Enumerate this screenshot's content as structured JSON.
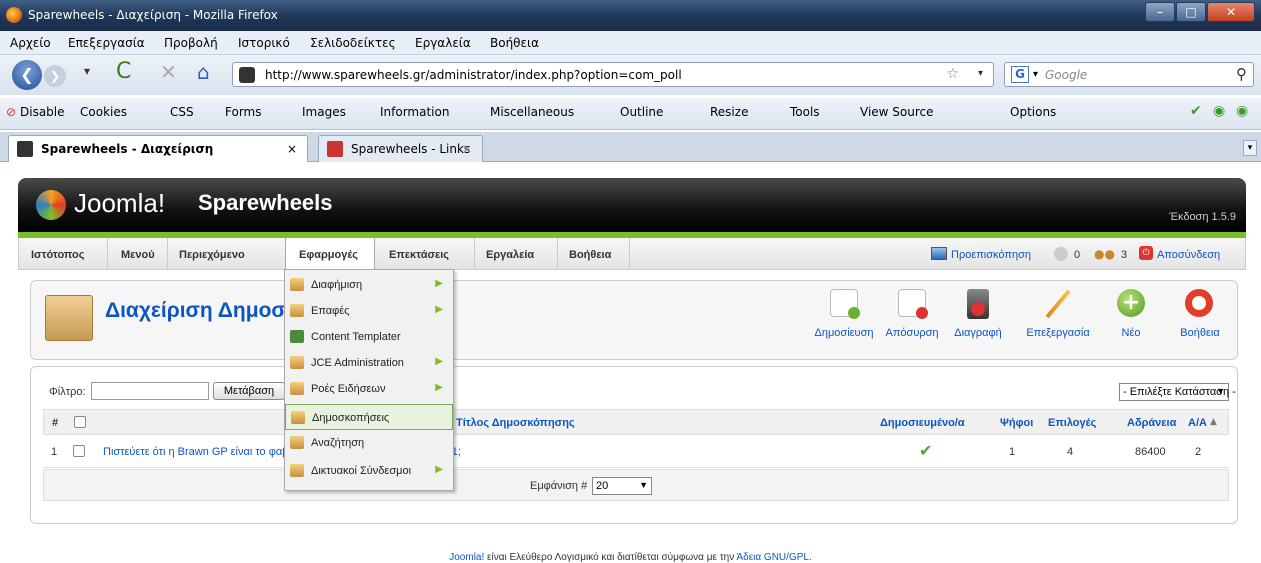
{
  "window": {
    "title": "Sparewheels - Διαχείριση - Mozilla Firefox"
  },
  "menu": [
    "Αρχείο",
    "Επεξεργασία",
    "Προβολή",
    "Ιστορικό",
    "Σελιδοδείκτες",
    "Εργαλεία",
    "Βοήθεια"
  ],
  "address": {
    "url": "http://www.sparewheels.gr/administrator/index.php?option=com_poll",
    "search_placeholder": "Google"
  },
  "devtools": [
    "Disable",
    "Cookies",
    "CSS",
    "Forms",
    "Images",
    "Information",
    "Miscellaneous",
    "Outline",
    "Resize",
    "Tools",
    "View Source",
    "Options"
  ],
  "tabs": [
    {
      "label": "Sparewheels - Διαχείριση"
    },
    {
      "label": "Sparewheels - Links"
    }
  ],
  "joomla": {
    "logo": "Joomla!",
    "site": "Sparewheels",
    "version": "Έκδοση 1.5.9",
    "nav": [
      "Ιστότοπος",
      "Μενού",
      "Περιεχόμενο",
      "Εφαρμογές",
      "Επεκτάσεις",
      "Εργαλεία",
      "Βοήθεια"
    ],
    "preview": "Προεπισκόπηση",
    "count_a": "0",
    "count_b": "3",
    "logout": "Αποσύνδεση",
    "page_title": "Διαχείριση Δημοσκοπήσεων",
    "toolbar": [
      "Δημοσίευση",
      "Απόσυρση",
      "Διαγραφή",
      "Επεξεργασία",
      "Νέο",
      "Βοήθεια"
    ],
    "filter_label": "Φίλτρο:",
    "go_button": "Μετάβαση",
    "status_select": "- Επιλέξτε Κατάσταση -",
    "columns": {
      "num": "#",
      "title": "Τίτλος Δημοσκόπησης",
      "published": "Δημοσιευμένο/α",
      "votes": "Ψήφοι",
      "options": "Επιλογές",
      "lag": "Αδράνεια",
      "id": "Α/Α"
    },
    "rows": [
      {
        "num": "1",
        "title": "Πιστεύετε ότι η Brawn GP είναι το φαβορί για τον τίτλο του τίτλου στην F1;",
        "votes": "1",
        "options": "4",
        "lag": "86400",
        "id": "2"
      }
    ],
    "display_label": "Εμφάνιση #",
    "display_value": "20",
    "footer_link": "Joomla!",
    "footer_text": "είναι Ελεύθερο Λογισμικό και διατίθεται σύμφωνα με την",
    "footer_license": "Άδεια GNU/GPL.",
    "dropdown": [
      {
        "label": "Διαφήμιση",
        "sub": true
      },
      {
        "label": "Επαφές",
        "sub": true
      },
      {
        "label": "Content Templater",
        "sub": false
      },
      {
        "label": "JCE Administration",
        "sub": true
      },
      {
        "label": "Ροές Ειδήσεων",
        "sub": true
      },
      {
        "label": "Δημοσκοπήσεις",
        "sub": false
      },
      {
        "label": "Αναζήτηση",
        "sub": false
      },
      {
        "label": "Δικτυακοί Σύνδεσμοι",
        "sub": true
      }
    ]
  }
}
